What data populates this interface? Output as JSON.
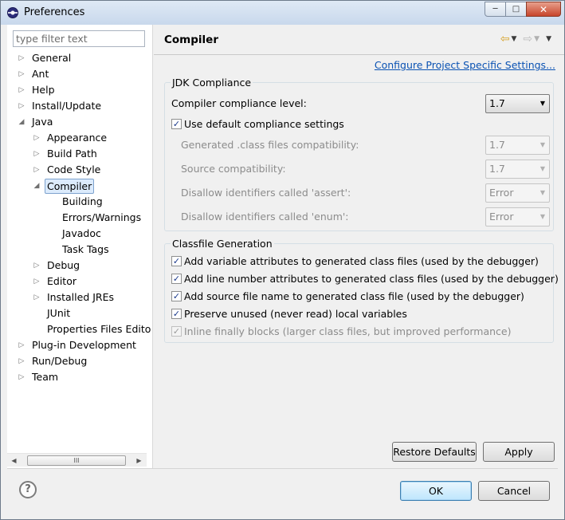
{
  "window": {
    "title": "Preferences",
    "minimize_glyph": "─",
    "maximize_glyph": "□",
    "close_glyph": "✕"
  },
  "filter": {
    "placeholder": "type filter text",
    "value": ""
  },
  "tree": {
    "collapsed_glyph": "▷",
    "expanded_glyph": "◢",
    "items": [
      {
        "label": "General",
        "level": 0,
        "state": "collapsed"
      },
      {
        "label": "Ant",
        "level": 0,
        "state": "collapsed"
      },
      {
        "label": "Help",
        "level": 0,
        "state": "collapsed"
      },
      {
        "label": "Install/Update",
        "level": 0,
        "state": "collapsed"
      },
      {
        "label": "Java",
        "level": 0,
        "state": "expanded"
      },
      {
        "label": "Appearance",
        "level": 1,
        "state": "collapsed"
      },
      {
        "label": "Build Path",
        "level": 1,
        "state": "collapsed"
      },
      {
        "label": "Code Style",
        "level": 1,
        "state": "collapsed"
      },
      {
        "label": "Compiler",
        "level": 1,
        "state": "expanded",
        "selected": true
      },
      {
        "label": "Building",
        "level": 2,
        "state": "leaf"
      },
      {
        "label": "Errors/Warnings",
        "level": 2,
        "state": "leaf"
      },
      {
        "label": "Javadoc",
        "level": 2,
        "state": "leaf"
      },
      {
        "label": "Task Tags",
        "level": 2,
        "state": "leaf"
      },
      {
        "label": "Debug",
        "level": 1,
        "state": "collapsed"
      },
      {
        "label": "Editor",
        "level": 1,
        "state": "collapsed"
      },
      {
        "label": "Installed JREs",
        "level": 1,
        "state": "collapsed"
      },
      {
        "label": "JUnit",
        "level": 1,
        "state": "leaf"
      },
      {
        "label": "Properties Files Edito",
        "level": 1,
        "state": "leaf"
      },
      {
        "label": "Plug-in Development",
        "level": 0,
        "state": "collapsed"
      },
      {
        "label": "Run/Debug",
        "level": 0,
        "state": "collapsed"
      },
      {
        "label": "Team",
        "level": 0,
        "state": "collapsed"
      }
    ]
  },
  "scrollbar": {
    "left_glyph": "◀",
    "right_glyph": "▶",
    "thumb_grip": "III"
  },
  "page": {
    "title": "Compiler",
    "nav": {
      "back_glyph": "⇦",
      "forward_glyph": "⇨",
      "dropdown_glyph": "▼"
    },
    "config_link": "Configure Project Specific Settings..."
  },
  "jdk": {
    "title": "JDK Compliance",
    "compliance_label": "Compiler compliance level:",
    "compliance_value": "1.7",
    "use_default_label": "Use default compliance settings",
    "use_default_checked": true,
    "rows": [
      {
        "label": "Generated .class files compatibility:",
        "value": "1.7"
      },
      {
        "label": "Source compatibility:",
        "value": "1.7"
      },
      {
        "label": "Disallow identifiers called 'assert':",
        "value": "Error"
      },
      {
        "label": "Disallow identifiers called 'enum':",
        "value": "Error"
      }
    ]
  },
  "classfile": {
    "title": "Classfile Generation",
    "options": [
      {
        "label": "Add variable attributes to generated class files (used by the debugger)",
        "checked": true,
        "enabled": true
      },
      {
        "label": "Add line number attributes to generated class files (used by the debugger)",
        "checked": true,
        "enabled": true
      },
      {
        "label": "Add source file name to generated class file (used by the debugger)",
        "checked": true,
        "enabled": true
      },
      {
        "label": "Preserve unused (never read) local variables",
        "checked": true,
        "enabled": true
      },
      {
        "label": "Inline finally blocks (larger class files, but improved performance)",
        "checked": true,
        "enabled": false
      }
    ]
  },
  "buttons": {
    "restore_defaults": "Restore Defaults",
    "apply": "Apply",
    "ok": "OK",
    "cancel": "Cancel",
    "help_glyph": "?"
  },
  "glyphs": {
    "check": "✓",
    "combo_arrow": "▼"
  }
}
